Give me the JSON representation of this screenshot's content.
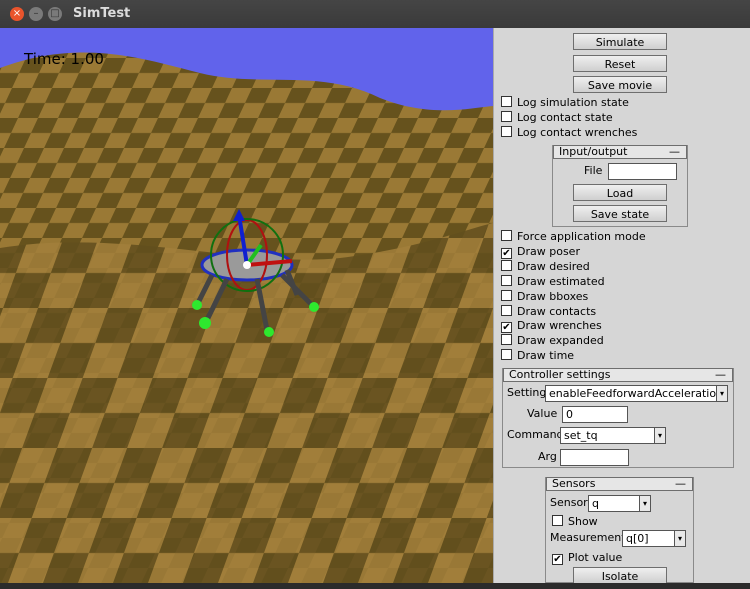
{
  "window": {
    "title": "SimTest",
    "close_glyph": "×",
    "min_glyph": "–",
    "max_glyph": "□"
  },
  "viewport": {
    "time_label": "Time: 1.00",
    "sky_color": "#6a6cff",
    "terrain_light": "#a8843a",
    "terrain_dark": "#6f5a20"
  },
  "panel": {
    "simulate_label": "Simulate",
    "reset_label": "Reset",
    "save_movie_label": "Save movie",
    "log_sim_label": "Log simulation state",
    "log_contact_label": "Log contact state",
    "log_wrenches_label": "Log contact wrenches",
    "io": {
      "title": "Input/output",
      "collapse": "—",
      "file_label": "File",
      "file_value": "",
      "load_label": "Load",
      "save_state_label": "Save state"
    },
    "draw": [
      {
        "label": "Force application mode",
        "checked": false
      },
      {
        "label": "Draw poser",
        "checked": true
      },
      {
        "label": "Draw desired",
        "checked": false
      },
      {
        "label": "Draw estimated",
        "checked": false
      },
      {
        "label": "Draw bboxes",
        "checked": false
      },
      {
        "label": "Draw contacts",
        "checked": false
      },
      {
        "label": "Draw wrenches",
        "checked": true
      },
      {
        "label": "Draw expanded",
        "checked": false
      },
      {
        "label": "Draw time",
        "checked": false
      }
    ],
    "controller": {
      "title": "Controller settings",
      "collapse": "—",
      "setting_label": "Setting",
      "setting_value": "enableFeedforwardAcceleration",
      "value_label": "Value",
      "value_value": "0",
      "command_label": "Command",
      "command_value": "set_tq",
      "arg_label": "Arg",
      "arg_value": ""
    },
    "sensors": {
      "title": "Sensors",
      "collapse": "—",
      "sensor_label": "Sensor",
      "sensor_value": "q",
      "show_label": "Show",
      "show_checked": false,
      "measurement_label": "Measurement",
      "measurement_value": "q[0]",
      "plot_label": "Plot value",
      "plot_checked": true,
      "isolate_label": "Isolate"
    },
    "check_glyph": "✔",
    "dropdown_glyph": "▾"
  }
}
